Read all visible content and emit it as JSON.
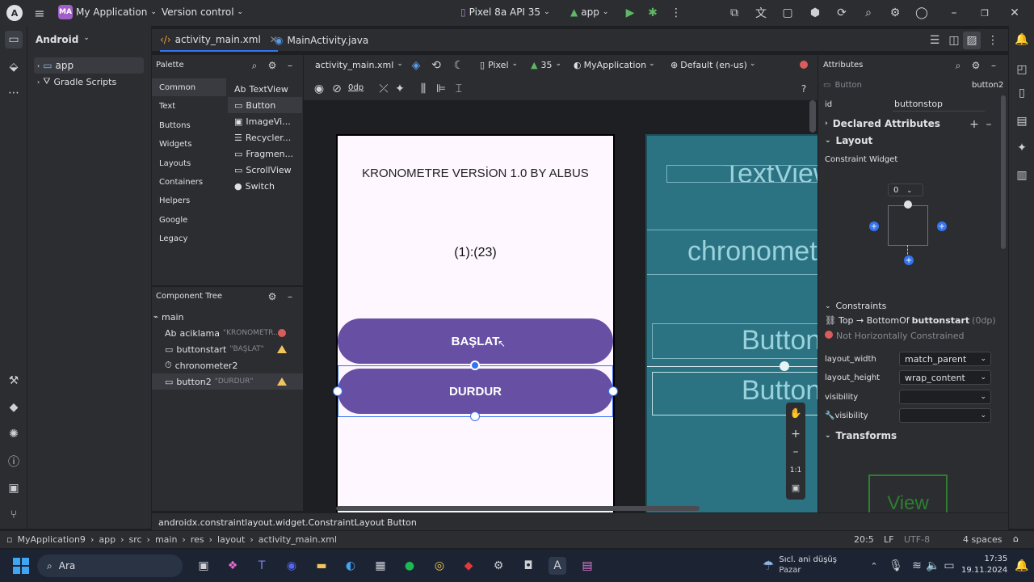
{
  "titlebar": {
    "project_badge": "MA",
    "project_name": "My Application",
    "vcs": "Version control",
    "device": "Pixel 8a API 35",
    "run_config": "app"
  },
  "project_panel": {
    "view_mode": "Android",
    "items": [
      {
        "label": "app"
      },
      {
        "label": "Gradle Scripts"
      }
    ]
  },
  "tabs": [
    {
      "label": "activity_main.xml"
    },
    {
      "label": "MainActivity.java"
    }
  ],
  "palette": {
    "title": "Palette",
    "categories": [
      "Common",
      "Text",
      "Buttons",
      "Widgets",
      "Layouts",
      "Containers",
      "Helpers",
      "Google",
      "Legacy"
    ],
    "items": [
      {
        "icon": "Ab",
        "label": "TextView"
      },
      {
        "icon": "▭",
        "label": "Button"
      },
      {
        "icon": "▣",
        "label": "ImageVi..."
      },
      {
        "icon": "☰",
        "label": "Recycler..."
      },
      {
        "icon": "▭",
        "label": "Fragmen..."
      },
      {
        "icon": "▭",
        "label": "ScrollView"
      },
      {
        "icon": "●",
        "label": "Switch"
      }
    ]
  },
  "component_tree": {
    "title": "Component Tree",
    "rows": [
      {
        "label": "main",
        "hint": ""
      },
      {
        "label": "aciklama",
        "hint": "\"KRONOMETR...",
        "status": "error"
      },
      {
        "label": "buttonstart",
        "hint": "\"BAŞLAT\"",
        "status": "warning"
      },
      {
        "label": "chronometer2",
        "hint": ""
      },
      {
        "label": "button2",
        "hint": "\"DURDUR\"",
        "status": "warning"
      }
    ]
  },
  "design_toolbar": {
    "file": "activity_main.xml",
    "device": "Pixel",
    "api": "35",
    "theme": "MyApplication",
    "locale": "Default (en-us)",
    "margin": "0dp"
  },
  "preview": {
    "title_text": "KRONOMETRE VERSİON 1.0 BY ALBUS",
    "chronometer": "(1):(23)",
    "start_button": "BAŞLAT",
    "stop_button": "DURDUR"
  },
  "blueprint": {
    "textview": "TextView",
    "chronometer": "chronometer",
    "button1": "Button",
    "button2": "Button",
    "zoom_label": "1:1"
  },
  "attributes": {
    "title": "Attributes",
    "widget_type": "Button",
    "widget_id_right": "button2",
    "id_label": "id",
    "id_value": "buttonstop",
    "declared": "Declared Attributes",
    "layout": "Layout",
    "constraint_widget": "Constraint Widget",
    "margin_value": "0",
    "constraints": "Constraints",
    "constraint_top": "Top → BottomOf",
    "constraint_target": "buttonstart",
    "constraint_dp": "(0dp)",
    "constraint_warn": "Not Horizontally Constrained",
    "layout_width_label": "layout_width",
    "layout_width": "match_parent",
    "layout_height_label": "layout_height",
    "layout_height": "wrap_content",
    "visibility_label": "visibility",
    "visibility_tools_label": "visibility",
    "transforms": "Transforms",
    "view_label": "View"
  },
  "breadcrumb": {
    "path1": "androidx.constraintlayout.widget.ConstraintLayout",
    "path2": "Button"
  },
  "status": {
    "crumbs": [
      "MyApplication9",
      "app",
      "src",
      "main",
      "res",
      "layout",
      "activity_main.xml"
    ],
    "position": "20:5",
    "line_sep": "LF",
    "encoding": "UTF-8",
    "indent": "4 spaces"
  },
  "taskbar": {
    "search": "Ara",
    "weather_title": "Sıcl. ani düşüş",
    "weather_sub": "Pazar",
    "time": "17:35",
    "date": "19.11.2024"
  },
  "colors": {
    "accent": "#6750a4",
    "blueprint": "#2b7283",
    "selection": "#3574f0"
  }
}
